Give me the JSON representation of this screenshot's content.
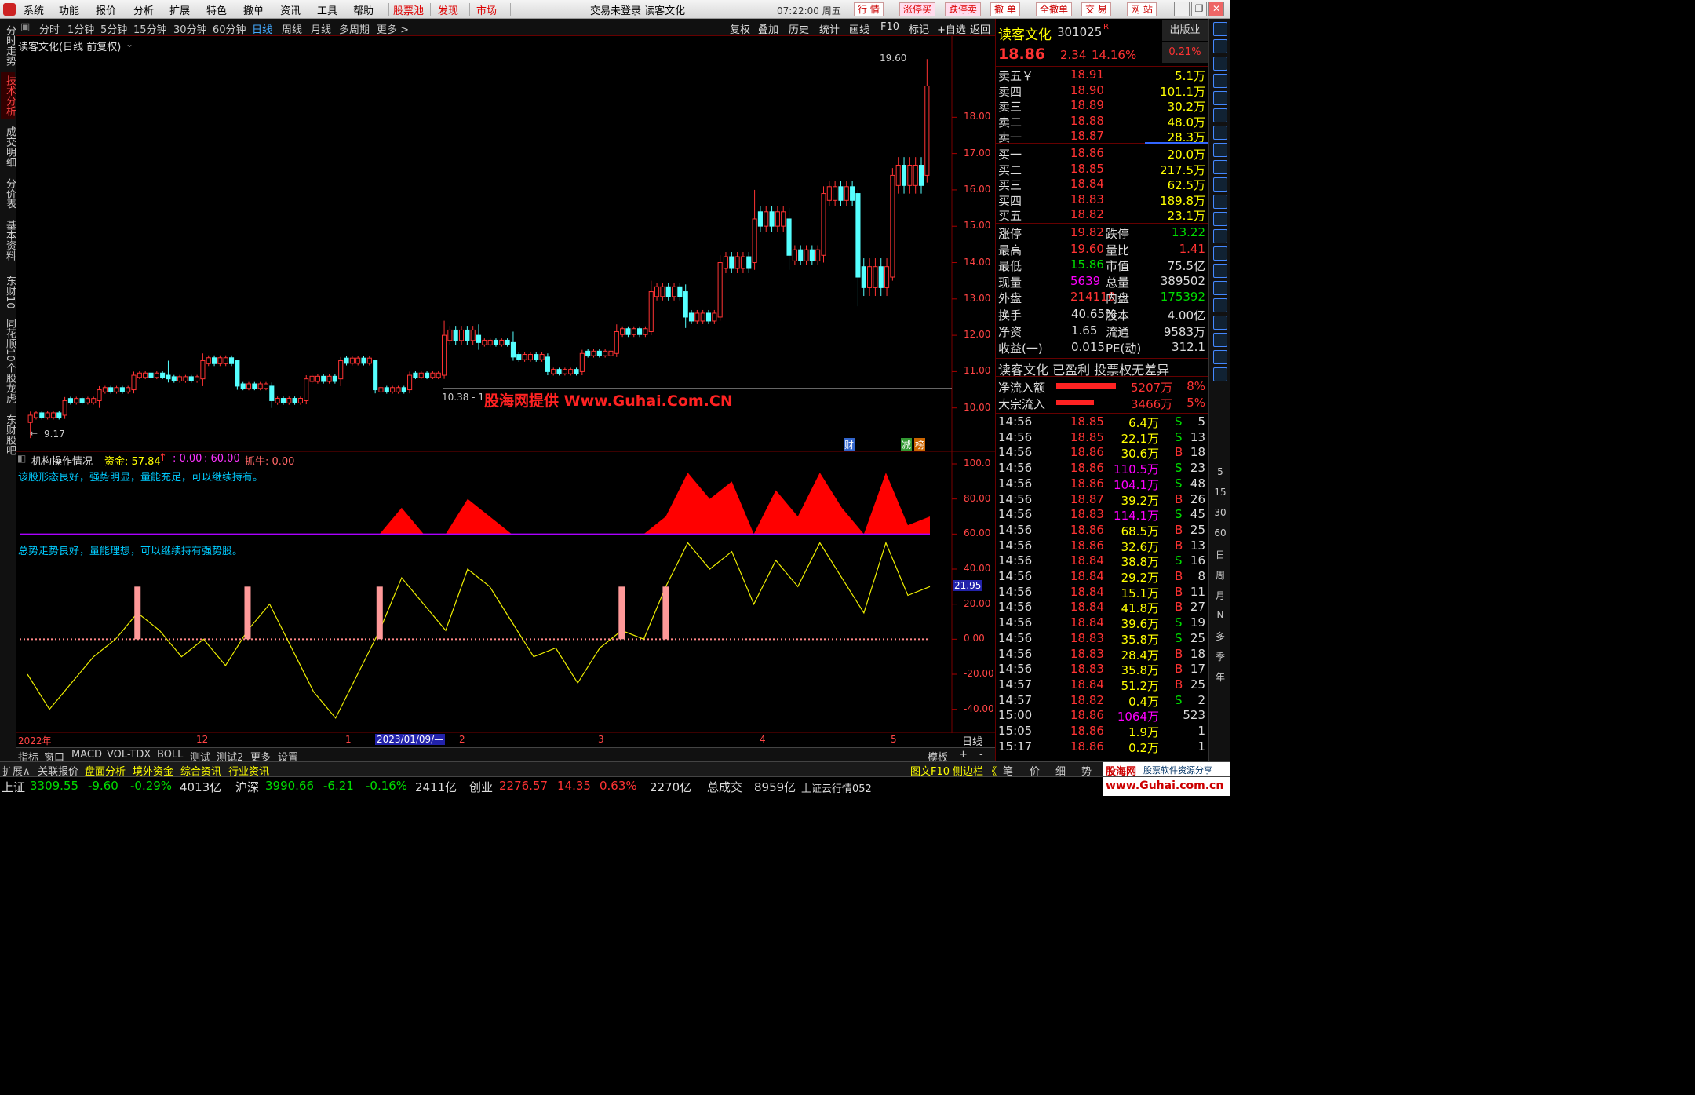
{
  "menu": {
    "items": [
      "系统",
      "功能",
      "报价",
      "分析",
      "扩展",
      "特色",
      "撤单",
      "资讯",
      "工具",
      "帮助"
    ],
    "red_items": [
      "股票池",
      "发现",
      "市场"
    ],
    "title": "交易未登录  读客文化",
    "clock": "07:22:00 周五",
    "trade_buttons": [
      "行 情",
      "涨停买",
      "跌停卖",
      "撤 单",
      "全撤单",
      "交 易",
      "网 站"
    ]
  },
  "left_tabs": [
    "分时走势",
    "技术分析",
    "成交明细",
    "分价表",
    "基本资料",
    "东财10",
    "同花顺10",
    "个股龙虎",
    "东财股吧"
  ],
  "period_bar": {
    "items": [
      "分时",
      "1分钟",
      "5分钟",
      "15分钟",
      "30分钟",
      "60分钟",
      "日线",
      "周线",
      "月线",
      "多周期",
      "更多 >"
    ],
    "active": "日线",
    "right": [
      "复权",
      "叠加",
      "历史",
      "统计",
      "画线",
      "F10",
      "标记",
      "+自选",
      "返回"
    ]
  },
  "chart": {
    "title": "读客文化(日线 前复权)",
    "price_axis": [
      "18.00",
      "17.00",
      "16.00",
      "15.00",
      "14.00",
      "13.00",
      "12.00",
      "11.00",
      "10.00"
    ],
    "high_label": "19.60",
    "low_label": "9.17",
    "range_label": "10.38 - 1",
    "watermark": "股海网提供 Www.Guhai.Com.CN",
    "markers": [
      "财",
      "减",
      "榜"
    ],
    "indicator_header": {
      "name": "机构操作情况",
      "fund_label": "资金: 57.84",
      "fund_arrow": "↑",
      "v1": ": 0.00",
      "v2": ": 60.00",
      "bull": "抓牛: 0.00"
    },
    "msg1": "该股形态良好，强势明显，量能充足，可以继续持有。",
    "msg2": "总势走势良好，量能理想，可以继续持有强势股。",
    "ind_axis": [
      "100.0",
      "80.00",
      "60.00",
      "40.00",
      "20.00",
      "0.00",
      "-20.00",
      "-40.00"
    ],
    "ind_current": "21.95",
    "date_axis": [
      "2022年",
      "12",
      "1",
      "2023/01/09/—",
      "2",
      "3",
      "4",
      "5"
    ],
    "period_label": "日线"
  },
  "chart_data": {
    "type": "candlestick",
    "title": "读客文化(日线 前复权)",
    "ylim": [
      9.0,
      19.8
    ],
    "x": [
      "2022-11",
      "2022-12",
      "2023-01",
      "2023-02",
      "2023-03",
      "2023-04",
      "2023-05"
    ],
    "ohlc": [
      [
        9.6,
        9.9,
        9.17,
        9.8
      ],
      [
        9.8,
        10.3,
        9.7,
        10.2
      ],
      [
        10.2,
        10.6,
        10.0,
        10.5
      ],
      [
        10.5,
        11.0,
        10.4,
        10.9
      ],
      [
        10.9,
        11.3,
        10.7,
        10.8
      ],
      [
        10.8,
        11.5,
        10.6,
        11.3
      ],
      [
        11.3,
        11.2,
        10.5,
        10.6
      ],
      [
        10.6,
        10.7,
        10.0,
        10.2
      ],
      [
        10.2,
        10.9,
        10.1,
        10.8
      ],
      [
        10.8,
        11.4,
        10.6,
        11.3
      ],
      [
        11.3,
        11.0,
        10.4,
        10.5
      ],
      [
        10.5,
        11.0,
        10.4,
        10.9
      ],
      [
        10.9,
        12.4,
        10.8,
        12.0
      ],
      [
        12.0,
        12.3,
        11.6,
        11.8
      ],
      [
        11.8,
        12.1,
        11.3,
        11.4
      ],
      [
        11.4,
        11.5,
        10.9,
        11.0
      ],
      [
        11.0,
        11.6,
        10.9,
        11.5
      ],
      [
        11.5,
        12.3,
        11.4,
        12.1
      ],
      [
        12.1,
        13.5,
        12.0,
        13.2
      ],
      [
        13.2,
        13.4,
        12.2,
        12.5
      ],
      [
        12.5,
        14.2,
        12.4,
        14.0
      ],
      [
        14.0,
        16.0,
        13.8,
        15.2
      ],
      [
        15.2,
        15.5,
        13.8,
        14.2
      ],
      [
        14.2,
        16.1,
        14.0,
        15.9
      ],
      [
        15.9,
        16.0,
        12.8,
        13.6
      ],
      [
        13.6,
        16.6,
        13.5,
        16.4
      ],
      [
        16.4,
        19.6,
        16.2,
        18.86
      ]
    ],
    "indicator": {
      "name": "机构操作情况",
      "fund": 57.84,
      "levels": [
        0,
        60
      ],
      "ylim": [
        -50,
        100
      ],
      "line": [
        -20,
        -40,
        -25,
        -10,
        0,
        15,
        5,
        -10,
        0,
        -15,
        5,
        20,
        -5,
        -30,
        -45,
        -20,
        5,
        35,
        20,
        5,
        40,
        30,
        10,
        -10,
        -5,
        -25,
        -5,
        5,
        0,
        30,
        55,
        40,
        50,
        20,
        45,
        30,
        55,
        35,
        15,
        55,
        25,
        30
      ]
    }
  },
  "quote": {
    "name": "读客文化",
    "code": "301025",
    "r_mark": "R",
    "badge": "出版业",
    "price": "18.86",
    "change": "2.34",
    "pct": "14.16%",
    "badge_pct": "0.21%",
    "asks": [
      {
        "label": "卖五￥",
        "price": "18.91",
        "vol": "5.1万"
      },
      {
        "label": "卖四",
        "price": "18.90",
        "vol": "101.1万"
      },
      {
        "label": "卖三",
        "price": "18.89",
        "vol": "30.2万"
      },
      {
        "label": "卖二",
        "price": "18.88",
        "vol": "48.0万"
      },
      {
        "label": "卖一",
        "price": "18.87",
        "vol": "28.3万"
      }
    ],
    "bids": [
      {
        "label": "买一",
        "price": "18.86",
        "vol": "20.0万"
      },
      {
        "label": "买二",
        "price": "18.85",
        "vol": "217.5万"
      },
      {
        "label": "买三",
        "price": "18.84",
        "vol": "62.5万"
      },
      {
        "label": "买四",
        "price": "18.83",
        "vol": "189.8万"
      },
      {
        "label": "买五",
        "price": "18.82",
        "vol": "23.1万"
      }
    ],
    "stats": [
      [
        "涨停",
        "19.82",
        "跌停",
        "13.22"
      ],
      [
        "最高",
        "19.60",
        "量比",
        "1.41"
      ],
      [
        "最低",
        "15.86",
        "市值",
        "75.5亿"
      ],
      [
        "现量",
        "5639",
        "总量",
        "389502"
      ],
      [
        "外盘",
        "214110",
        "内盘",
        "175392"
      ]
    ],
    "stats2": [
      [
        "换手",
        "40.65%",
        "股本",
        "4.00亿"
      ],
      [
        "净资",
        "1.65",
        "流通",
        "9583万"
      ],
      [
        "收益(一)",
        "0.015",
        "PE(动)",
        "312.1"
      ]
    ],
    "profile": "读客文化 已盈利 投票权无差异",
    "flows": [
      {
        "label": "净流入额",
        "value": "5207万",
        "pct": "8%",
        "level": 0.8
      },
      {
        "label": "大宗流入",
        "value": "3466万",
        "pct": "5%",
        "level": 0.5
      }
    ],
    "ticks": [
      [
        "14:56",
        "18.85",
        "6.4万",
        "S",
        "5"
      ],
      [
        "14:56",
        "18.85",
        "22.1万",
        "S",
        "13"
      ],
      [
        "14:56",
        "18.86",
        "30.6万",
        "B",
        "18"
      ],
      [
        "14:56",
        "18.86",
        "110.5万",
        "S",
        "23"
      ],
      [
        "14:56",
        "18.86",
        "104.1万",
        "S",
        "48"
      ],
      [
        "14:56",
        "18.87",
        "39.2万",
        "B",
        "26"
      ],
      [
        "14:56",
        "18.83",
        "114.1万",
        "S",
        "45"
      ],
      [
        "14:56",
        "18.86",
        "68.5万",
        "B",
        "25"
      ],
      [
        "14:56",
        "18.86",
        "32.6万",
        "B",
        "13"
      ],
      [
        "14:56",
        "18.84",
        "38.8万",
        "S",
        "16"
      ],
      [
        "14:56",
        "18.84",
        "29.2万",
        "B",
        "8"
      ],
      [
        "14:56",
        "18.84",
        "15.1万",
        "B",
        "11"
      ],
      [
        "14:56",
        "18.84",
        "41.8万",
        "B",
        "27"
      ],
      [
        "14:56",
        "18.84",
        "39.6万",
        "S",
        "19"
      ],
      [
        "14:56",
        "18.83",
        "35.8万",
        "S",
        "25"
      ],
      [
        "14:56",
        "18.83",
        "28.4万",
        "B",
        "18"
      ],
      [
        "14:56",
        "18.83",
        "35.8万",
        "B",
        "17"
      ],
      [
        "14:57",
        "18.84",
        "51.2万",
        "B",
        "25"
      ],
      [
        "14:57",
        "18.82",
        "0.4万",
        "S",
        "2"
      ],
      [
        "15:00",
        "18.86",
        "1064万",
        "",
        "523"
      ],
      [
        "15:05",
        "18.86",
        "1.9万",
        "",
        "1"
      ],
      [
        "15:17",
        "18.86",
        "0.2万",
        "",
        "1"
      ]
    ]
  },
  "right_tools": [
    "5",
    "15",
    "30",
    "60",
    "日",
    "周",
    "月",
    "N",
    "多",
    "季",
    "年"
  ],
  "bottom_tabs": [
    "指标",
    "窗口",
    "MACD",
    "VOL-TDX",
    "BOLL",
    "测试",
    "测试2",
    "更多",
    "设置"
  ],
  "bottom_right": [
    "模板",
    "+",
    "-"
  ],
  "bottom2": {
    "left": [
      "扩展∧",
      "关联报价",
      "盘面分析",
      "境外资金",
      "综合资讯",
      "行业资讯"
    ],
    "right": [
      "图文F10",
      "侧边栏 《"
    ],
    "quote_tabs": [
      "笔",
      "价",
      "细",
      "势"
    ],
    "brand": "股海网",
    "brand_sub": "股票软件资源分享",
    "brand_url": "www.Guhai.com.cn"
  },
  "status": {
    "sh_label": "上证",
    "sh": "3309.55",
    "sh_chg": "-9.60",
    "sh_pct": "-0.29%",
    "sh_amt": "4013亿",
    "sz_label": "沪深",
    "sz": "3990.66",
    "sz_chg": "-6.21",
    "sz_pct": "-0.16%",
    "sz_amt": "2411亿",
    "cy_label": "创业",
    "cy": "2276.57",
    "cy_chg": "14.35",
    "cy_pct": "0.63%",
    "cy_amt": "2270亿",
    "total_label": "总成交",
    "total": "8959亿",
    "news": "上证云行情052"
  }
}
